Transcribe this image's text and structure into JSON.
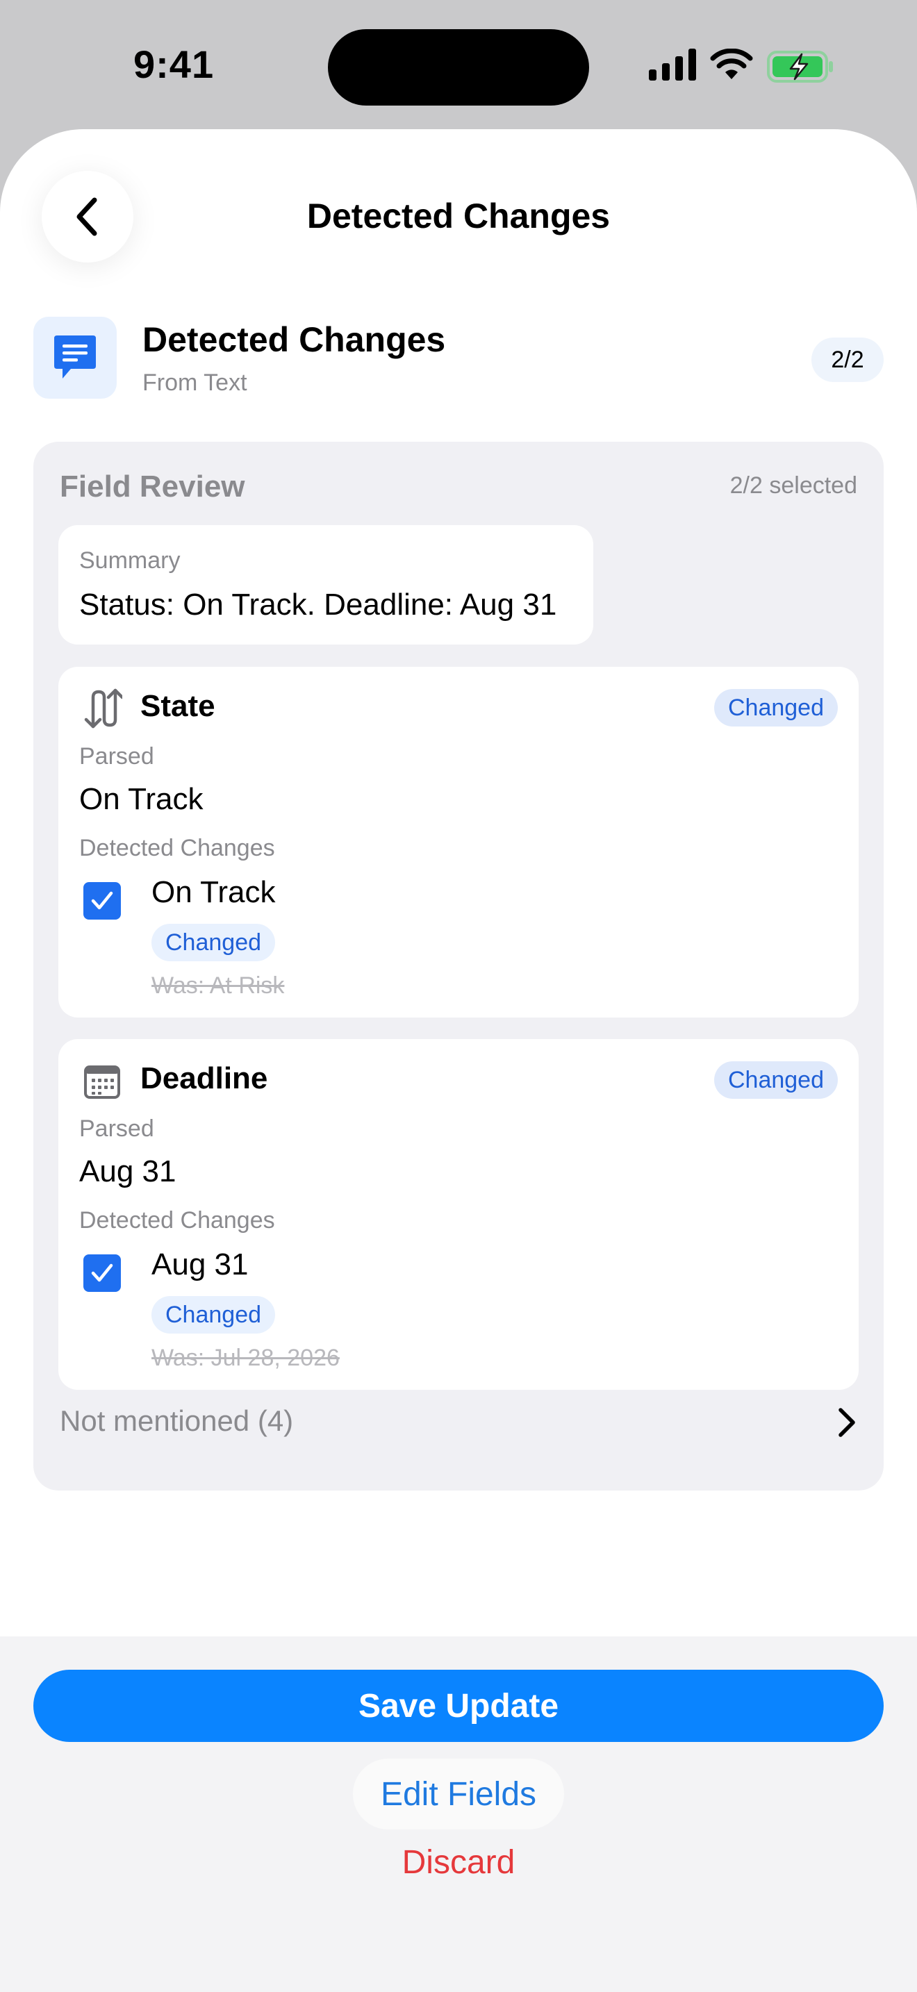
{
  "status_bar": {
    "time": "9:41"
  },
  "nav": {
    "title": "Detected Changes"
  },
  "source": {
    "title": "Detected Changes",
    "subtitle": "From Text",
    "count": "2/2"
  },
  "review": {
    "title": "Field Review",
    "selected": "2/2 selected",
    "summary": {
      "label": "Summary",
      "value": "Status: On Track. Deadline: Aug 31"
    },
    "fields": [
      {
        "name": "State",
        "icon": "swap-arrows-icon",
        "badge": "Changed",
        "parsed_label": "Parsed",
        "parsed_value": "On Track",
        "detected_label": "Detected Changes",
        "change_value": "On Track",
        "change_badge": "Changed",
        "was": "Was: At Risk",
        "checked": true
      },
      {
        "name": "Deadline",
        "icon": "calendar-icon",
        "badge": "Changed",
        "parsed_label": "Parsed",
        "parsed_value": "Aug 31",
        "detected_label": "Detected Changes",
        "change_value": "Aug 31",
        "change_badge": "Changed",
        "was": "Was: Jul 28, 2026",
        "checked": true
      }
    ],
    "not_mentioned": "Not mentioned (4)"
  },
  "footer": {
    "save": "Save Update",
    "edit": "Edit Fields",
    "discard": "Discard"
  },
  "colors": {
    "accent": "#0a84ff",
    "badge_text": "#1f5fd6",
    "danger": "#e5383b",
    "checkbox": "#1f6ff0"
  }
}
